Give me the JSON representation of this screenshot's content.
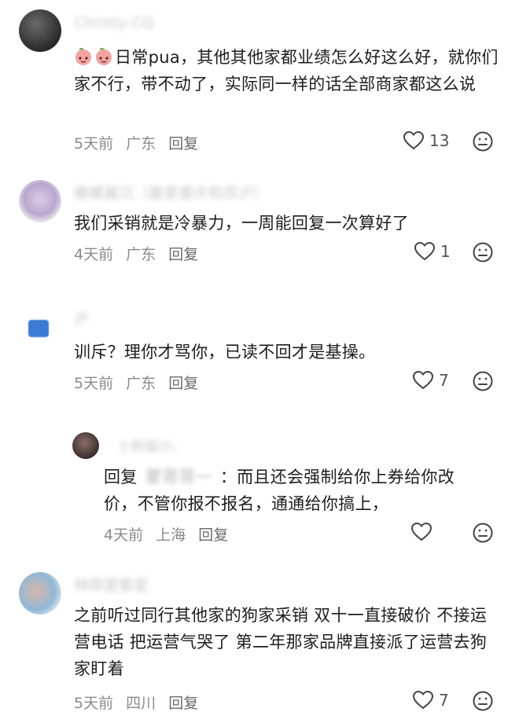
{
  "comments": [
    {
      "username": "Christy-CQ",
      "emojis": [
        "peach-emoji",
        "peach-emoji"
      ],
      "text": "日常pua，其他其他家都业绩怎么好这么好，就你们家不行，带不动了，实际同一样的话全部商家都这么说",
      "time": "5天前",
      "location": "广东",
      "reply_label": "回复",
      "likes": "13"
    },
    {
      "username": "螺螺酱沉（最爱重庆和苏沪）",
      "text": "我们采销就是冷暴力，一周能回复一次算好了",
      "time": "4天前",
      "location": "广东",
      "reply_label": "回复",
      "likes": "1"
    },
    {
      "username": "沪",
      "text": "训斥？理你才骂你，已读不回才是基操。",
      "time": "5天前",
      "location": "广东",
      "reply_label": "回复",
      "likes": "7"
    },
    {
      "username": "小熊猫沙。",
      "reply_prefix": "回复",
      "reply_to": "蒙哥哥一",
      "text_first": "：而且还会强制给你上券给你改",
      "text_rest": "价，不管你报不报名，通通给你搞上，",
      "time": "4天前",
      "location": "上海",
      "reply_label": "回复",
      "likes": ""
    },
    {
      "username": "林荫里繁星",
      "text": "之前听过同行其他家的狗家采销 双十一直接破价 不接运营电话 把运营气哭了 第二年那家品牌直接派了运营去狗家盯着",
      "time": "5天前",
      "location": "四川",
      "reply_label": "回复",
      "likes": "7"
    }
  ],
  "colors": {
    "text": "#1d1d1d",
    "meta": "#8a8a8a",
    "icon": "#444444"
  }
}
